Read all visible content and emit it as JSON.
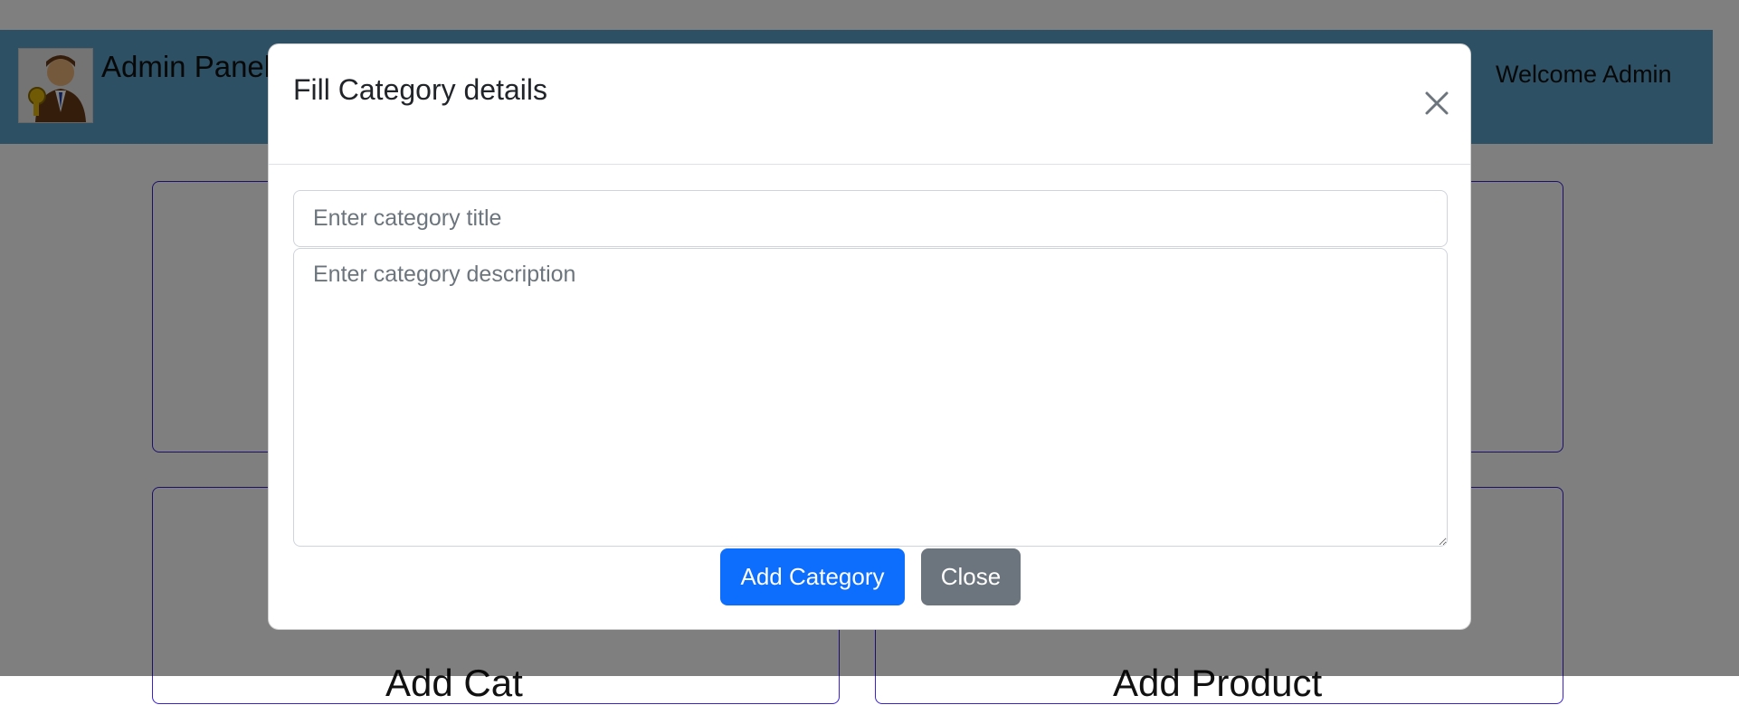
{
  "header": {
    "brand": "Admin Panel",
    "welcome": "Welcome Admin"
  },
  "background_cards": {
    "card3_label": "Add Cat",
    "card4_label": "Add Product"
  },
  "modal": {
    "title": "Fill Category details",
    "title_input": {
      "placeholder": "Enter category title",
      "value": ""
    },
    "description_input": {
      "placeholder": "Enter category description",
      "value": ""
    },
    "add_label": "Add Category",
    "close_label": "Close"
  },
  "colors": {
    "header_bg": "#5aa1c8",
    "primary": "#0d6efd",
    "secondary": "#6c757d",
    "card_border": "#3a20d6"
  },
  "icons": {
    "logo": "admin-avatar-logo",
    "modal_close": "close-icon"
  }
}
